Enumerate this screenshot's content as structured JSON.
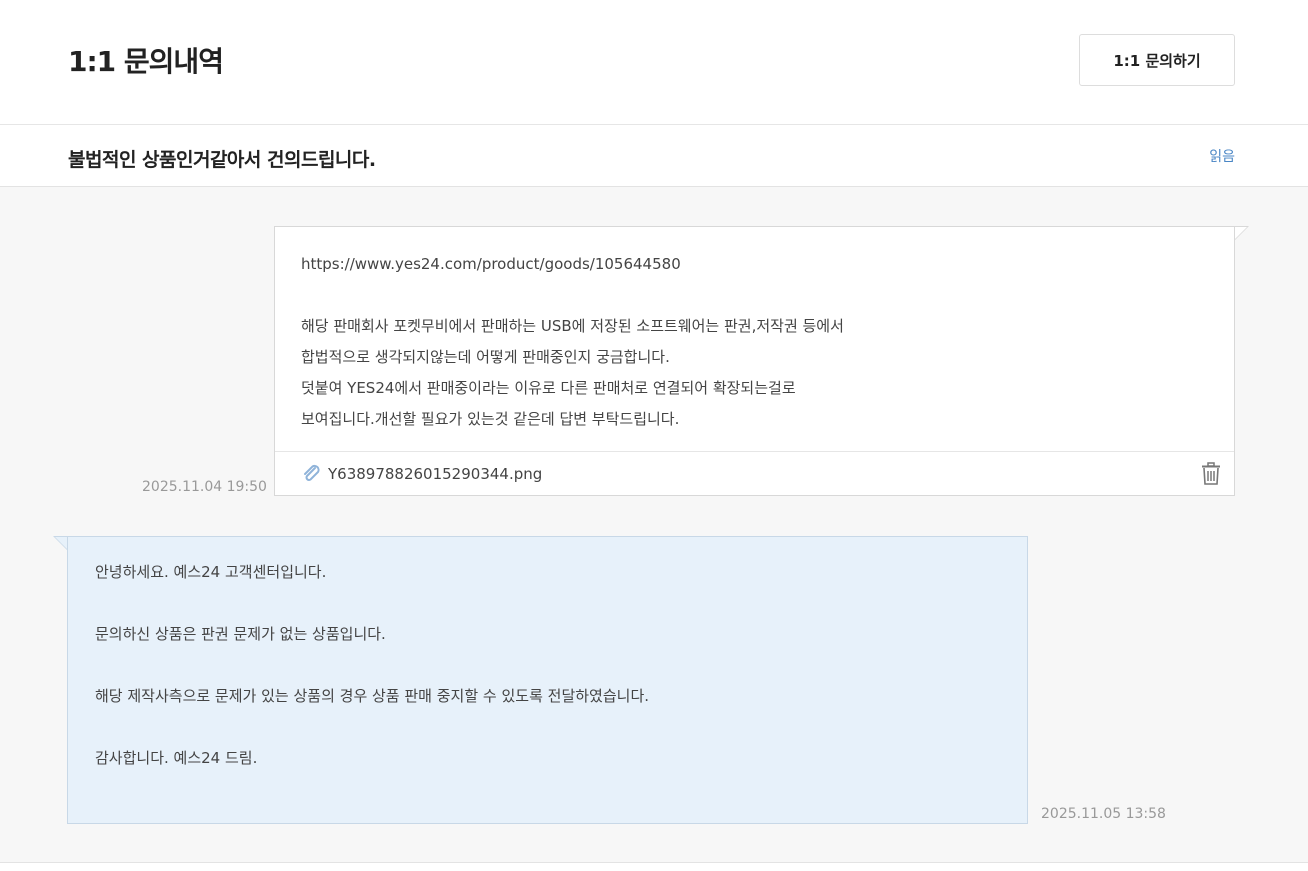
{
  "header": {
    "title": "1:1 문의내역",
    "ask_button": "1:1 문의하기"
  },
  "inquiry": {
    "subject": "불법적인 상품인거같아서 건의드립니다.",
    "status": "읽음"
  },
  "question": {
    "lines": [
      "https://www.yes24.com/product/goods/105644580",
      "",
      "해당 판매회사 포켓무비에서 판매하는 USB에 저장된 소프트웨어는 판권,저작권 등에서",
      "합법적으로 생각되지않는데 어떻게 판매중인지 궁금합니다.",
      "덧붙여 YES24에서 판매중이라는 이유로 다른 판매처로 연결되어 확장되는걸로",
      "보여집니다.개선할 필요가 있는것 같은데 답변 부탁드립니다."
    ],
    "attachment": "Y638978826015290344.png",
    "timestamp": "2025.11.04 19:50"
  },
  "answer": {
    "lines": [
      "안녕하세요. 예스24 고객센터입니다.",
      "",
      "문의하신 상품은 판권 문제가 없는 상품입니다.",
      "",
      "해당 제작사측으로 문제가 있는 상품의 경우 상품 판매 중지할 수 있도록 전달하였습니다.",
      "",
      "감사합니다. 예스24 드림."
    ],
    "timestamp": "2025.11.05 13:58"
  },
  "colors": {
    "accent": "#4a86c5",
    "answer_bg": "#e7f1fa",
    "thread_bg": "#f7f7f7"
  }
}
